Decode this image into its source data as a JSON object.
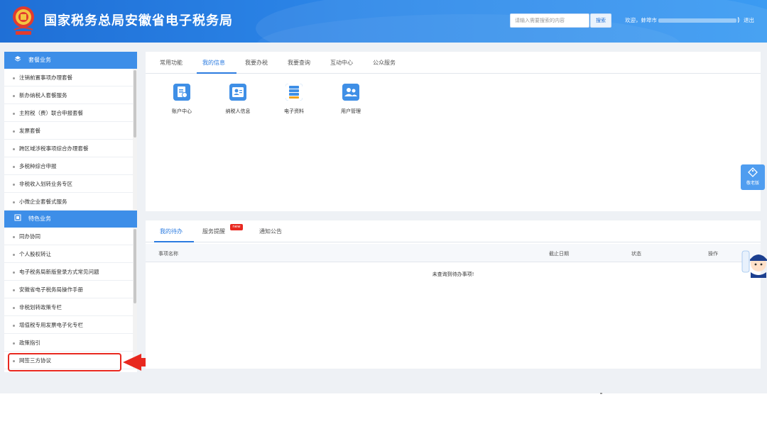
{
  "header": {
    "title": "国家税务总局安徽省电子税务局",
    "search_placeholder": "请输入需要搜索的内容",
    "search_button": "搜索",
    "welcome_prefix": "欢迎，蚌埠市",
    "welcome_suffix": "）",
    "separator": "|",
    "logout": "退出"
  },
  "sidebar": {
    "section1": {
      "title": "套餐业务",
      "items": [
        "注销前置事项办理套餐",
        "新办纳税人套餐服务",
        "主附税（费）联合申报套餐",
        "发票套餐",
        "跨区域涉税事项综合办理套餐",
        "多税种综合申报",
        "非税收入划转业务专区",
        "小微企业套餐式服务"
      ]
    },
    "section2": {
      "title": "特色业务",
      "items": [
        "同办协同",
        "个人股权转让",
        "电子税务局新版登录方式常见问题",
        "安徽省电子税务局操作手册",
        "非税划转政策专栏",
        "增值税专用发票电子化专栏",
        "政策指引",
        "网签三方协议"
      ]
    }
  },
  "main": {
    "tabs": [
      "常用功能",
      "我的信息",
      "我要办税",
      "我要查询",
      "互动中心",
      "公众服务"
    ],
    "active_tab": "我的信息",
    "shortcuts": [
      "账户中心",
      "纳税人信息",
      "电子资料",
      "用户管理"
    ]
  },
  "todo": {
    "tabs": [
      "我的待办",
      "服务提醒",
      "通知公告"
    ],
    "new_badge": "new",
    "columns": [
      "事项名称",
      "截止日期",
      "状态",
      "操作"
    ],
    "empty_message": "未查询到待办事项!"
  },
  "widgets": {
    "tag_label": "敬老版"
  },
  "colors": {
    "header_blue": "#2c86e8",
    "accent": "#2b7be0",
    "highlight_red": "#e8281f"
  }
}
